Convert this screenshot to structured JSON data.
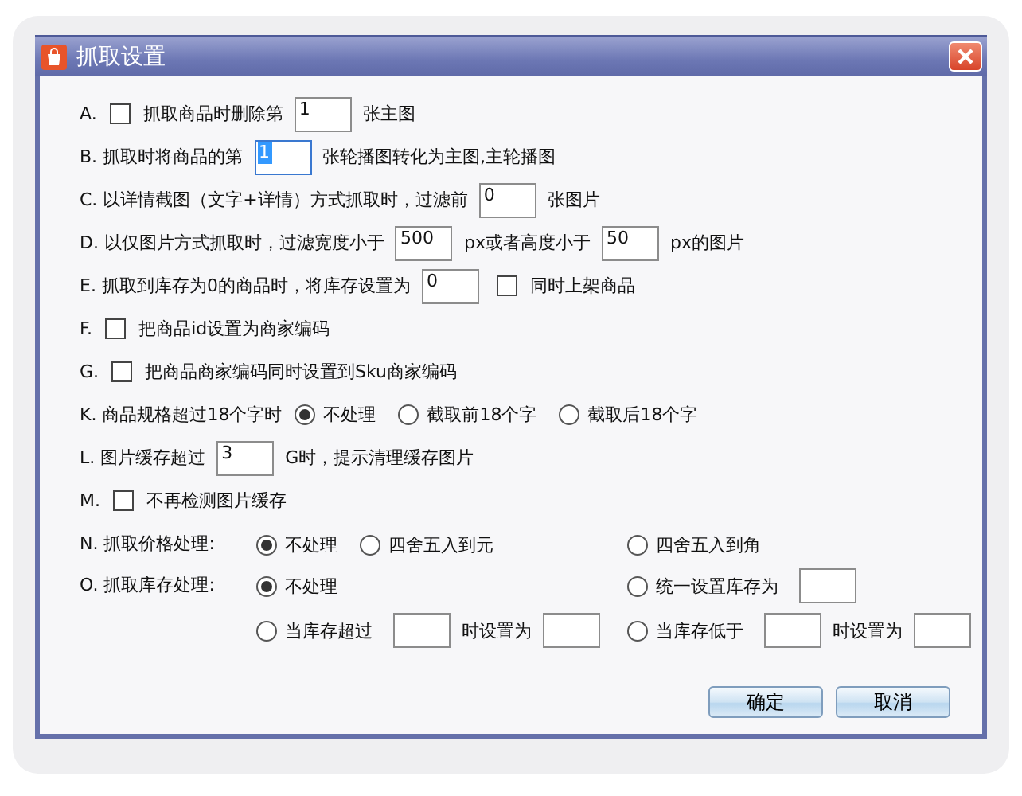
{
  "window": {
    "title": "抓取设置"
  },
  "rows": [
    {
      "kind": "flow",
      "items": [
        {
          "kind": "text",
          "text": "A."
        },
        {
          "kind": "checkbox",
          "checked": false
        },
        {
          "kind": "text",
          "text": "抓取商品时删除第"
        },
        {
          "kind": "field",
          "value": "1",
          "focused": false
        },
        {
          "kind": "text",
          "text": "张主图"
        }
      ]
    },
    {
      "kind": "flow",
      "items": [
        {
          "kind": "text",
          "text": "B. 抓取时将商品的第"
        },
        {
          "kind": "field",
          "value": "1",
          "focused": true
        },
        {
          "kind": "text",
          "text": "张轮播图转化为主图,主轮播图"
        }
      ]
    },
    {
      "kind": "flow",
      "items": [
        {
          "kind": "text",
          "text": "C. 以详情截图（文字+详情）方式抓取时，过滤前"
        },
        {
          "kind": "field",
          "value": "0",
          "focused": false
        },
        {
          "kind": "text",
          "text": "张图片"
        }
      ]
    },
    {
      "kind": "flow",
      "items": [
        {
          "kind": "text",
          "text": "D. 以仅图片方式抓取时，过滤宽度小于"
        },
        {
          "kind": "field",
          "value": "500",
          "focused": false
        },
        {
          "kind": "text",
          "text": "px或者高度小于"
        },
        {
          "kind": "field",
          "value": "50",
          "focused": false
        },
        {
          "kind": "text",
          "text": "px的图片"
        }
      ]
    },
    {
      "kind": "flow",
      "items": [
        {
          "kind": "text",
          "text": "E. 抓取到库存为0的商品时，将库存设置为"
        },
        {
          "kind": "field",
          "value": "0",
          "focused": false
        },
        {
          "kind": "checkbox",
          "checked": false
        },
        {
          "kind": "text",
          "text": "同时上架商品"
        }
      ]
    },
    {
      "kind": "flow",
      "items": [
        {
          "kind": "text",
          "text": "F."
        },
        {
          "kind": "checkbox",
          "checked": false
        },
        {
          "kind": "text",
          "text": "把商品id设置为商家编码"
        }
      ]
    },
    {
      "kind": "flow",
      "items": [
        {
          "kind": "text",
          "text": "G."
        },
        {
          "kind": "checkbox",
          "checked": false
        },
        {
          "kind": "text",
          "text": "把商品商家编码同时设置到Sku商家编码"
        }
      ]
    },
    {
      "kind": "flow",
      "items": [
        {
          "kind": "text",
          "text": "K. 商品规格超过18个字时"
        },
        {
          "kind": "radio",
          "label": "不处理",
          "selected": true
        },
        {
          "kind": "radio",
          "label": "截取前18个字",
          "selected": false
        },
        {
          "kind": "radio",
          "label": "截取后18个字",
          "selected": false
        }
      ]
    },
    {
      "kind": "flow",
      "items": [
        {
          "kind": "text",
          "text": "L. 图片缓存超过"
        },
        {
          "kind": "field",
          "value": "3",
          "focused": false
        },
        {
          "kind": "text",
          "text": "G时，提示清理缓存图片"
        }
      ]
    },
    {
      "kind": "flow",
      "items": [
        {
          "kind": "text",
          "text": "M."
        },
        {
          "kind": "checkbox",
          "checked": false
        },
        {
          "kind": "text",
          "text": "不再检测图片缓存"
        }
      ]
    },
    {
      "kind": "grid",
      "label": "N. 抓取价格处理:",
      "lines": [
        [
          [
            {
              "kind": "radio",
              "label": "不处理",
              "selected": true
            },
            {
              "kind": "radio",
              "label": "四舍五入到元",
              "selected": false
            }
          ],
          [
            {
              "kind": "radio",
              "label": "四舍五入到角",
              "selected": false
            }
          ]
        ]
      ]
    },
    {
      "kind": "grid",
      "label": "O. 抓取库存处理:",
      "lines": [
        [
          [
            {
              "kind": "radio",
              "label": "不处理",
              "selected": true
            }
          ],
          [
            {
              "kind": "radio",
              "label": "统一设置库存为",
              "selected": false
            },
            {
              "kind": "field"
            }
          ]
        ],
        [
          [
            {
              "kind": "radio",
              "label": "当库存超过",
              "selected": false
            },
            {
              "kind": "field"
            },
            {
              "kind": "text",
              "text": "时设置为"
            },
            {
              "kind": "field"
            }
          ],
          [
            {
              "kind": "radio",
              "label": "当库存低于",
              "selected": false
            },
            {
              "kind": "field"
            },
            {
              "kind": "text",
              "text": "时设置为"
            },
            {
              "kind": "field"
            }
          ]
        ]
      ]
    }
  ],
  "buttons": [
    "确定",
    "取消"
  ]
}
